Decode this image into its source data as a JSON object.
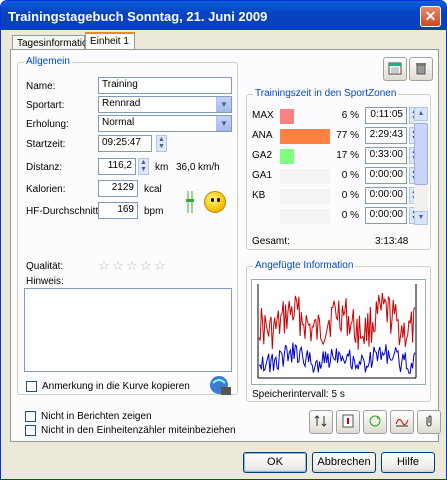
{
  "window": {
    "title": "Trainingstagebuch   Sonntag, 21. Juni 2009",
    "close_glyph": "✕"
  },
  "tabs": [
    {
      "label": "Tagesinformation"
    },
    {
      "label": "Einheit 1"
    }
  ],
  "allgemein": {
    "title": "Allgemein",
    "name_label": "Name:",
    "name_value": "Training",
    "sportart_label": "Sportart:",
    "sportart_value": "Rennrad",
    "erholung_label": "Erholung:",
    "erholung_value": "Normal",
    "startzeit_label": "Startzeit:",
    "startzeit_value": "09:25:47",
    "distanz_label": "Distanz:",
    "distanz_value": "116,2",
    "distanz_unit": "km",
    "speed_value": "36,0",
    "speed_unit": "km/h",
    "kalorien_label": "Kalorien:",
    "kalorien_value": "2129",
    "kalorien_unit": "kcal",
    "hf_label": "HF-Durchschnitt:",
    "hf_value": "169",
    "hf_unit": "bpm",
    "qualitaet_label": "Qualität:",
    "qualitaet_stars": 0,
    "hinweis_label": "Hinweis:",
    "hinweis_value": "",
    "anmerkung_label": "Anmerkung in die Kurve kopieren"
  },
  "zones": {
    "title": "Trainingszeit in den SportZonen",
    "rows": [
      {
        "name": "MAX",
        "pct": "6 %",
        "time": "0:11:05",
        "color": "#ff8080",
        "fraction": 0.06
      },
      {
        "name": "ANA",
        "pct": "77 %",
        "time": "2:29:43",
        "color": "#ff8040",
        "fraction": 0.77
      },
      {
        "name": "GA2",
        "pct": "17 %",
        "time": "0:33:00",
        "color": "#80ff80",
        "fraction": 0.17
      },
      {
        "name": "GA1",
        "pct": "0 %",
        "time": "0:00:00",
        "color": "#c0c0ff",
        "fraction": 0.0
      },
      {
        "name": "KB",
        "pct": "0 %",
        "time": "0:00:00",
        "color": "#e0e0e0",
        "fraction": 0.0
      },
      {
        "name": "",
        "pct": "0 %",
        "time": "0:00:00",
        "color": "#e0e0e0",
        "fraction": 0.0
      }
    ],
    "gesamt_label": "Gesamt:",
    "gesamt_value": "3:13:48"
  },
  "info": {
    "title": "Angefügte Information",
    "speicher_label": "Speicherintervall: 5 s"
  },
  "bottom": {
    "nicht_berichte": "Nicht in Berichten zeigen",
    "nicht_zaehler": "Nicht in den Einheitenzähler miteinbeziehen"
  },
  "buttons": {
    "ok": "OK",
    "abbrechen": "Abbrechen",
    "hilfe": "Hilfe"
  },
  "colors": {
    "graph_red": "#cc0000",
    "graph_blue": "#0000cc"
  }
}
